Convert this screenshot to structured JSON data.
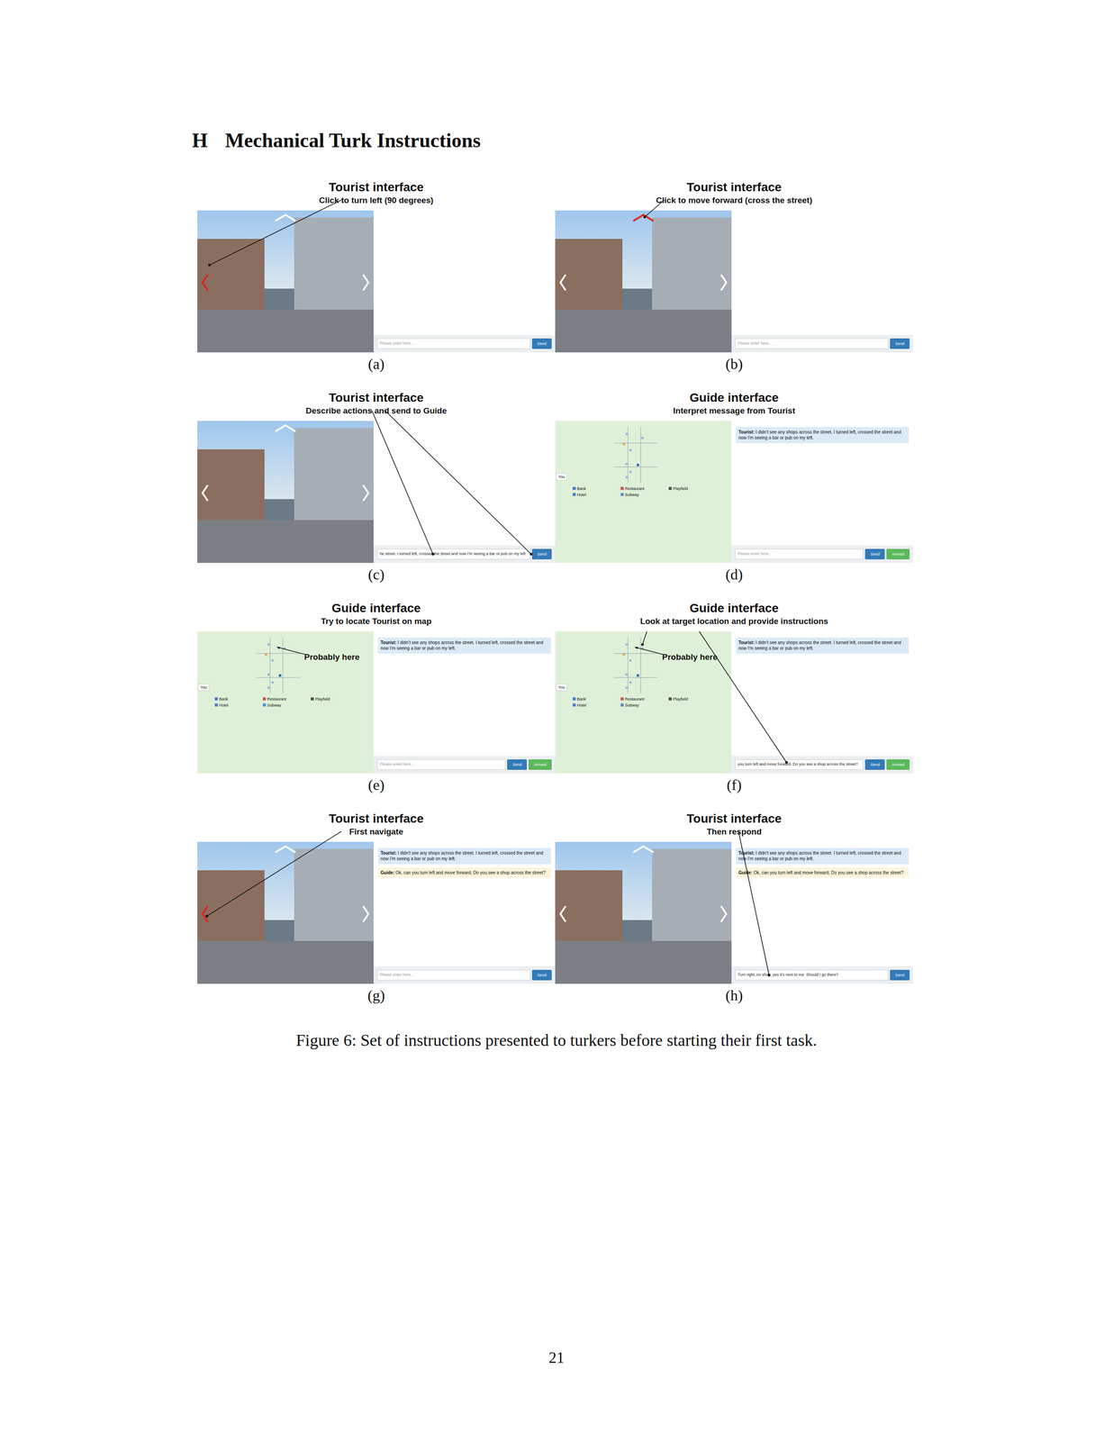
{
  "section": {
    "letter": "H",
    "title": "Mechanical Turk Instructions"
  },
  "panels": [
    {
      "label": "(a)",
      "role": "Tourist interface",
      "instruction": "Click to turn left (90 degrees)",
      "kind": "tourist",
      "highlight": "left",
      "messages": [],
      "input_text": "",
      "placeholder": "Please enter here...",
      "buttons": [
        "Send"
      ]
    },
    {
      "label": "(b)",
      "role": "Tourist interface",
      "instruction": "Click to move forward (cross the street)",
      "kind": "tourist",
      "highlight": "up",
      "messages": [],
      "input_text": "",
      "placeholder": "Please enter here...",
      "buttons": [
        "Send"
      ]
    },
    {
      "label": "(c)",
      "role": "Tourist interface",
      "instruction": "Describe actions and send to Guide",
      "kind": "tourist",
      "highlight": "none",
      "messages": [],
      "input_text": "he street. I turned left, crossed the street and now I'm seeing a bar or pub on my left",
      "placeholder": "Please enter here...",
      "buttons": [
        "Send"
      ]
    },
    {
      "label": "(d)",
      "role": "Guide interface",
      "instruction": "Interpret message from Tourist",
      "kind": "guide",
      "highlight": "none",
      "map_note": "",
      "messages": [
        {
          "speaker": "Tourist:",
          "text": "I didn't see any shops across the street. I turned left, crossed the street and now I'm seeing a bar or pub on my left.",
          "role": "tourist"
        }
      ],
      "input_text": "",
      "placeholder": "Please enter here...",
      "buttons": [
        "Send",
        "Arrived"
      ]
    },
    {
      "label": "(e)",
      "role": "Guide interface",
      "instruction": "Try to locate Tourist on map",
      "kind": "guide",
      "highlight": "none",
      "map_note": "Probably here",
      "messages": [
        {
          "speaker": "Tourist:",
          "text": "I didn't see any shops across the street. I turned left, crossed the street and now I'm seeing a bar or pub on my left.",
          "role": "tourist"
        }
      ],
      "input_text": "",
      "placeholder": "Please enter here...",
      "buttons": [
        "Send",
        "Arrived"
      ]
    },
    {
      "label": "(f)",
      "role": "Guide interface",
      "instruction": "Look at target location and provide instructions",
      "kind": "guide",
      "highlight": "none",
      "map_note": "Probably here",
      "messages": [
        {
          "speaker": "Tourist:",
          "text": "I didn't see any shops across the street. I turned left, crossed the street and now I'm seeing a bar or pub on my left.",
          "role": "tourist"
        }
      ],
      "input_text": "you turn left and move forward. Do you see a shop across the street?",
      "placeholder": "Please enter here...",
      "buttons": [
        "Send",
        "Arrived"
      ]
    },
    {
      "label": "(g)",
      "role": "Tourist interface",
      "instruction": "First navigate",
      "kind": "tourist",
      "highlight": "left",
      "messages": [
        {
          "speaker": "Tourist:",
          "text": "I didn't see any shops across the street. I turned left, crossed the street and now I'm seeing a bar or pub on my left.",
          "role": "tourist"
        },
        {
          "speaker": "Guide:",
          "text": "Ok, can you turn left and move forward. Do you see a shop across the street?",
          "role": "guide"
        }
      ],
      "input_text": "",
      "placeholder": "Please enter here...",
      "buttons": [
        "Send"
      ]
    },
    {
      "label": "(h)",
      "role": "Tourist interface",
      "instruction": "Then respond",
      "kind": "tourist",
      "highlight": "none",
      "messages": [
        {
          "speaker": "Tourist:",
          "text": "I didn't see any shops across the street. I turned left, crossed the street and now I'm seeing a bar or pub on my left.",
          "role": "tourist"
        },
        {
          "speaker": "Guide:",
          "text": "Ok, can you turn left and move forward. Do you see a shop across the street?",
          "role": "guide"
        }
      ],
      "input_text": "Turn right, no shop, yes it's next to me. Should I go there?",
      "placeholder": "Please enter here...",
      "buttons": [
        "Send"
      ]
    }
  ],
  "map": {
    "you": "You",
    "legend": [
      "Bank",
      "Restaurant",
      "Playfield",
      "Hotel",
      "Subway"
    ]
  },
  "caption": "Figure 6: Set of instructions presented to turkers before starting their first task.",
  "page_number": "21"
}
